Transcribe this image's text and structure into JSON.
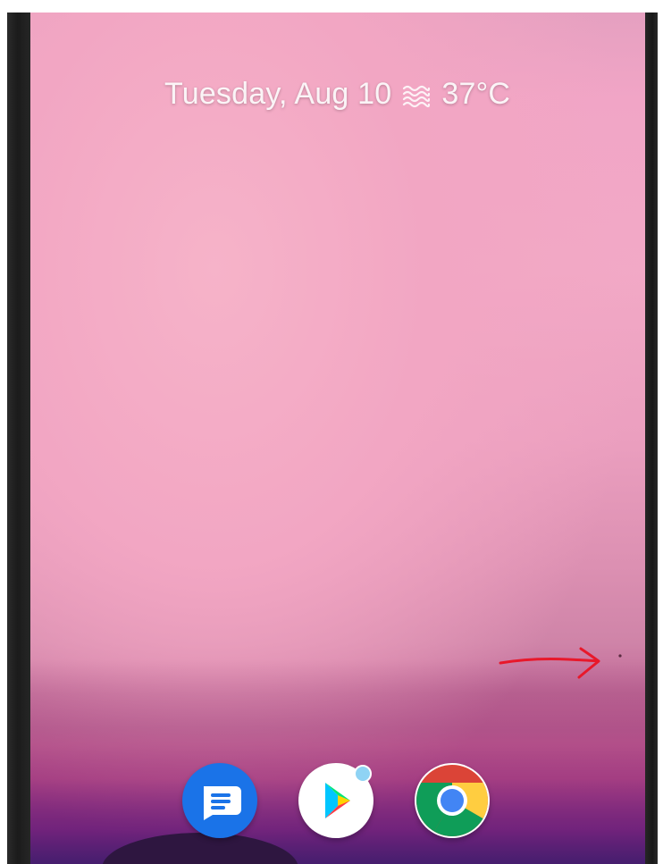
{
  "glance": {
    "date": "Tuesday, Aug 10",
    "weather_icon": "haze-icon",
    "temperature": "37°C"
  },
  "dock": {
    "apps": [
      {
        "name": "Messages",
        "icon": "messages-icon",
        "color": "#1a73e8"
      },
      {
        "name": "Play Store",
        "icon": "play-store-icon",
        "badge": true,
        "badge_color": "#8fd3f4"
      },
      {
        "name": "Chrome",
        "icon": "chrome-icon"
      }
    ]
  },
  "annotation": {
    "type": "arrow",
    "color": "#e8182a"
  }
}
